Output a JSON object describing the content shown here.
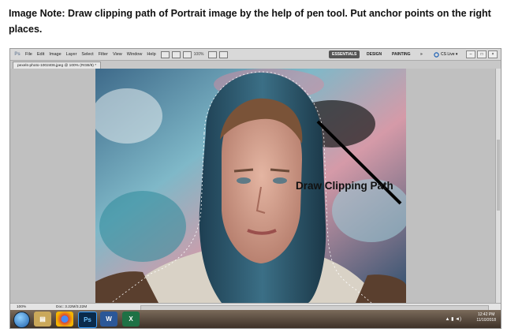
{
  "note": {
    "text": "Image Note: Draw clipping path of Portrait image by the help of pen tool. Put anchor points on the right places."
  },
  "app": {
    "logo": "Ps",
    "menu": [
      "File",
      "Edit",
      "Image",
      "Layer",
      "Select",
      "Filter",
      "View",
      "Window",
      "Help"
    ],
    "zoom_select": "100%",
    "workspaces": [
      "ESSENTIALS",
      "DESIGN",
      "PAINTING"
    ],
    "active_workspace": "ESSENTIALS",
    "more": "»",
    "cs_live": "CS Live ▾"
  },
  "document": {
    "tab_title": "pexels-photo-1002406.jpeg @ 100% (RGB/8) *",
    "zoom": "100%",
    "doc_size": "Doc: 3.22M/3.22M"
  },
  "annotation": {
    "label": "Draw Clipping Path"
  },
  "taskbar": {
    "apps": [
      "start",
      "file-explorer",
      "chrome",
      "photoshop",
      "word",
      "excel"
    ],
    "time": "12:42 PM",
    "date": "11/10/2018"
  }
}
